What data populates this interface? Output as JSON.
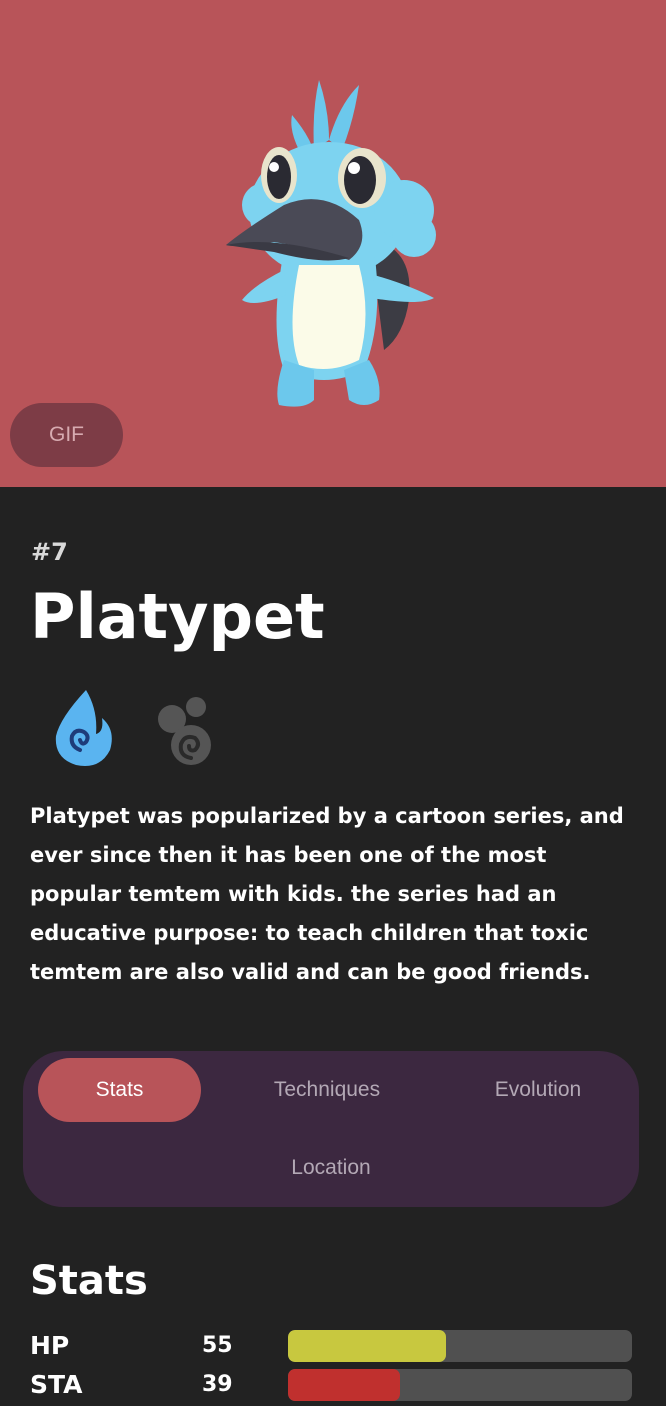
{
  "hero": {
    "background_color": "#b85459",
    "image": "platypet-sprite",
    "gif_button_label": "GIF"
  },
  "temtem": {
    "number": "#7",
    "name": "Platypet",
    "types": [
      {
        "name": "water",
        "icon": "water-type-icon",
        "color": "#5ab4f0"
      },
      {
        "name": "toxic",
        "icon": "toxic-type-icon",
        "color": "#555555"
      }
    ],
    "description": "Platypet was popularized by a cartoon series, and ever since then it has been one of the most popular temtem with kids. the series had an educative purpose: to teach children that toxic temtem are also valid and can be good friends."
  },
  "tabs": {
    "stats": "Stats",
    "techniques": "Techniques",
    "evolution": "Evolution",
    "location": "Location",
    "active": "Stats"
  },
  "stats": {
    "title": "Stats",
    "max_value": 120,
    "rows": [
      {
        "label": "HP",
        "value": "55",
        "color": "#c8c83f"
      },
      {
        "label": "STA",
        "value": "39",
        "color": "#c0302e"
      }
    ]
  }
}
